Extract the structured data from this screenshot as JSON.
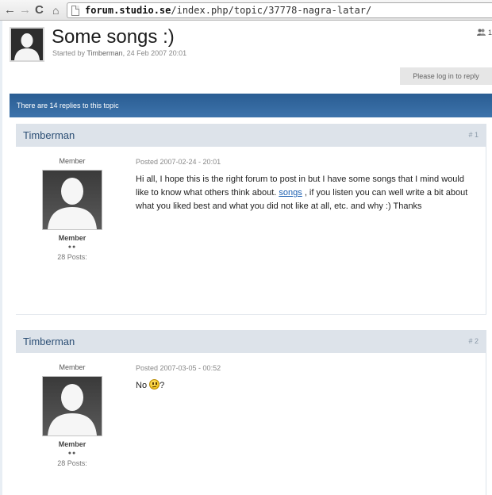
{
  "browser": {
    "back_glyph": "←",
    "forward_glyph": "→",
    "reload_glyph": "C",
    "home_glyph": "⌂",
    "url_host": "forum.studio.se",
    "url_path": "/index.php/topic/37778-nagra-latar/"
  },
  "topic": {
    "title": "Some songs :)",
    "started_prefix": "Started by",
    "started_by": "Timberman",
    "started_date": ", 24 Feb 2007 20:01",
    "top_right_count": "1",
    "login_label": "Please log in to reply",
    "replies_text": "There are 14 replies to this topic"
  },
  "posts": [
    {
      "author": "Timberman",
      "number": "# 1",
      "role": "Member",
      "group": "Member",
      "pips": "●●",
      "post_count": "28 Posts:",
      "posted": "Posted 2007-02-24 - 20:01",
      "body_before": "Hi all, I hope this is the right forum to post in but I have some songs that I mind would like to know what others think about.",
      "link_text": "songs",
      "body_after": ", if you listen you can well write a bit about what you liked best and what you did not like at all, etc. and why :) Thanks"
    },
    {
      "author": "Timberman",
      "number": "# 2",
      "role": "Member",
      "group": "Member",
      "pips": "●●",
      "post_count": "28 Posts:",
      "posted": "Posted 2007-03-05 - 00:52",
      "body_before": "No",
      "body_after": "?"
    }
  ],
  "icons": {
    "avatar": "default-user-silhouette",
    "top_right": "users-icon",
    "emoticon": "confused-smiley-icon"
  },
  "colors": {
    "replies_bar": "#2f6399",
    "post_header": "#dde3ea",
    "author_link": "#2c4f75",
    "body_link": "#1a5eb0"
  }
}
